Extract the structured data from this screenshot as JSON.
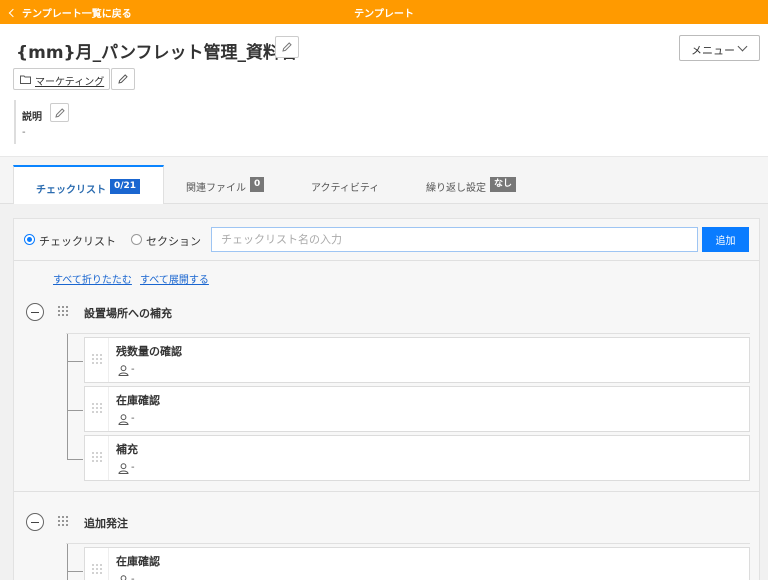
{
  "topbar": {
    "back_label": "テンプレート一覧に戻る",
    "title": "テンプレート"
  },
  "header": {
    "title": "{mm}月_パンフレット管理_資料名",
    "menu_label": "メニュー",
    "folder": "マーケティング",
    "description_label": "説明",
    "description_value": "-"
  },
  "tabs": [
    {
      "label": "チェックリスト",
      "badge": "0/21",
      "active": true
    },
    {
      "label": "関連ファイル",
      "badge": "0",
      "active": false
    },
    {
      "label": "アクティビティ",
      "badge": "",
      "active": false
    },
    {
      "label": "繰り返し設定",
      "badge": "なし",
      "active": false
    }
  ],
  "add_form": {
    "radio_checklist": "チェックリスト",
    "radio_section": "セクション",
    "selected": "チェックリスト",
    "placeholder": "チェックリスト名の入力",
    "value": "",
    "submit_label": "追加"
  },
  "links": {
    "collapse_all": "すべて折りたたむ",
    "expand_all": "すべて展開する"
  },
  "sections": [
    {
      "title": "設置場所への補充",
      "items": [
        {
          "name": "残数量の確認",
          "assignee": "-"
        },
        {
          "name": "在庫確認",
          "assignee": "-"
        },
        {
          "name": "補充",
          "assignee": "-"
        }
      ]
    },
    {
      "title": "追加発注",
      "items": [
        {
          "name": "在庫確認",
          "assignee": "-"
        }
      ]
    }
  ],
  "colors": {
    "topbar": "#ff9a00",
    "accent": "#0a7cff",
    "badge_active": "#1a66d0",
    "badge_inactive": "#777777"
  },
  "icons": {
    "back": "chevron-left-icon",
    "edit": "pencil-icon",
    "folder": "folder-icon",
    "menu": "chevron-down-icon",
    "collapse": "minus-circle-icon",
    "drag": "drag-grip-icon",
    "assignee": "person-icon"
  }
}
